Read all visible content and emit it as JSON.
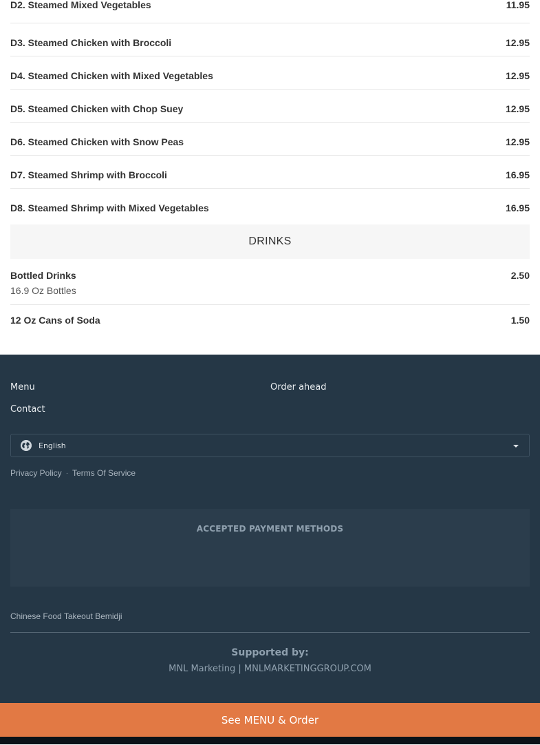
{
  "dishes": [
    {
      "name": "D2. Steamed Mixed Vegetables",
      "price": "11.95"
    },
    {
      "name": "D3. Steamed Chicken with Broccoli",
      "price": "12.95"
    },
    {
      "name": "D4. Steamed Chicken with Mixed Vegetables",
      "price": "12.95"
    },
    {
      "name": "D5. Steamed Chicken with Chop Suey",
      "price": "12.95"
    },
    {
      "name": "D6. Steamed Chicken with Snow Peas",
      "price": "12.95"
    },
    {
      "name": "D7. Steamed Shrimp with Broccoli",
      "price": "16.95"
    },
    {
      "name": "D8. Steamed Shrimp with Mixed Vegetables",
      "price": "16.95"
    }
  ],
  "drinks_section": {
    "title": "DRINKS"
  },
  "drinks": [
    {
      "name": "Bottled Drinks",
      "price": "2.50",
      "desc": "16.9 Oz Bottles"
    },
    {
      "name": "12 Oz Cans of Soda",
      "price": "1.50"
    }
  ],
  "footer": {
    "links": {
      "menu": "Menu",
      "order_ahead": "Order ahead",
      "contact": "Contact"
    },
    "language": {
      "selected": "English",
      "icon": "globe-icon"
    },
    "legal": {
      "privacy": "Privacy Policy",
      "separator": "·",
      "terms": "Terms Of Service"
    },
    "payments_title": "ACCEPTED PAYMENT METHODS",
    "takeout_link": "Chinese Food Takeout Bemidji",
    "supported_by": "Supported by:",
    "credit": "MNL Marketing | MNLMARKETINGGROUP.COM"
  },
  "cta": {
    "label": "See MENU & Order"
  },
  "colors": {
    "footer_bg": "#253746",
    "cta_bg": "#e27944"
  }
}
